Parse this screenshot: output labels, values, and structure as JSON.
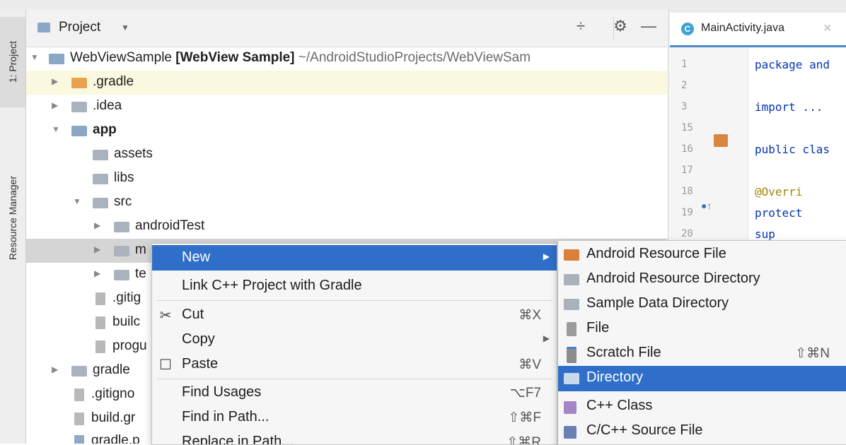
{
  "left_strip": {
    "project_tab": "1: Project",
    "resource_tab": "Resource Manager"
  },
  "project_panel": {
    "title": "Project",
    "tree": [
      {
        "label": "WebViewSample",
        "bold_part": "[WebView Sample]",
        "path": "~/AndroidStudioProjects/WebViewSam",
        "icon": "module-icon"
      },
      {
        "label": ".gradle",
        "icon": "folder-orange-icon"
      },
      {
        "label": ".idea",
        "icon": "folder-icon"
      },
      {
        "label": "app",
        "icon": "app-module-icon"
      },
      {
        "label": "assets",
        "icon": "folder-icon"
      },
      {
        "label": "libs",
        "icon": "folder-icon"
      },
      {
        "label": "src",
        "icon": "folder-icon"
      },
      {
        "label": "androidTest",
        "icon": "folder-icon"
      },
      {
        "label": "m",
        "icon": "folder-icon"
      },
      {
        "label": "te",
        "icon": "folder-icon"
      },
      {
        "label": ".gitig",
        "icon": "gitignore-icon"
      },
      {
        "label": "builc",
        "icon": "gradle-icon"
      },
      {
        "label": "progu",
        "icon": "file-icon"
      },
      {
        "label": "gradle",
        "icon": "folder-icon"
      },
      {
        "label": ".gitigno",
        "icon": "gitignore-icon"
      },
      {
        "label": "build.gr",
        "icon": "gradle-icon"
      },
      {
        "label": "gradle.p",
        "icon": "gradle-properties-icon"
      }
    ]
  },
  "editor": {
    "tab_label": "MainActivity.java",
    "tab_icon_letter": "C",
    "lines": [
      {
        "num": "1",
        "code": "package and"
      },
      {
        "num": "2",
        "code": ""
      },
      {
        "num": "3",
        "code": "import ..."
      },
      {
        "num": "15",
        "code": ""
      },
      {
        "num": "16",
        "code": "public clas"
      },
      {
        "num": "17",
        "code": ""
      },
      {
        "num": "18",
        "code": "    @Overri"
      },
      {
        "num": "19",
        "code": "    protect"
      },
      {
        "num": "20",
        "code": "        sup"
      }
    ]
  },
  "context_menu": {
    "items": [
      {
        "label": "New",
        "shortcut": "",
        "submenu": true,
        "icon": ""
      },
      {
        "label": "Link C++ Project with Gradle",
        "shortcut": "",
        "submenu": false,
        "icon": ""
      },
      {
        "label": "Cut",
        "shortcut": "⌘X",
        "submenu": false,
        "icon": "✂"
      },
      {
        "label": "Copy",
        "shortcut": "",
        "submenu": true,
        "icon": ""
      },
      {
        "label": "Paste",
        "shortcut": "⌘V",
        "submenu": false,
        "icon": "☐"
      },
      {
        "label": "Find Usages",
        "shortcut": "⌥F7",
        "submenu": false,
        "icon": ""
      },
      {
        "label": "Find in Path...",
        "shortcut": "⇧⌘F",
        "submenu": false,
        "icon": ""
      },
      {
        "label": "Replace in Path...",
        "shortcut": "⇧⌘R",
        "submenu": false,
        "icon": ""
      }
    ]
  },
  "submenu": {
    "items": [
      {
        "label": "Android Resource File",
        "shortcut": "",
        "icon": "android-resource-file-icon"
      },
      {
        "label": "Android Resource Directory",
        "shortcut": "",
        "icon": "folder-icon"
      },
      {
        "label": "Sample Data Directory",
        "shortcut": "",
        "icon": "folder-icon"
      },
      {
        "label": "File",
        "shortcut": "",
        "icon": "file-icon"
      },
      {
        "label": "Scratch File",
        "shortcut": "⇧⌘N",
        "icon": "scratch-file-icon"
      },
      {
        "label": "Directory",
        "shortcut": "",
        "icon": "folder-icon"
      },
      {
        "label": "C++ Class",
        "shortcut": "",
        "icon": "cpp-class-icon"
      },
      {
        "label": "C/C++ Source File",
        "shortcut": "",
        "icon": "cpp-source-icon"
      }
    ]
  },
  "colors": {
    "selection": "#2f6fc9",
    "tree_selected": "#d5d5d5",
    "highlight_row": "#fbf8e0"
  }
}
